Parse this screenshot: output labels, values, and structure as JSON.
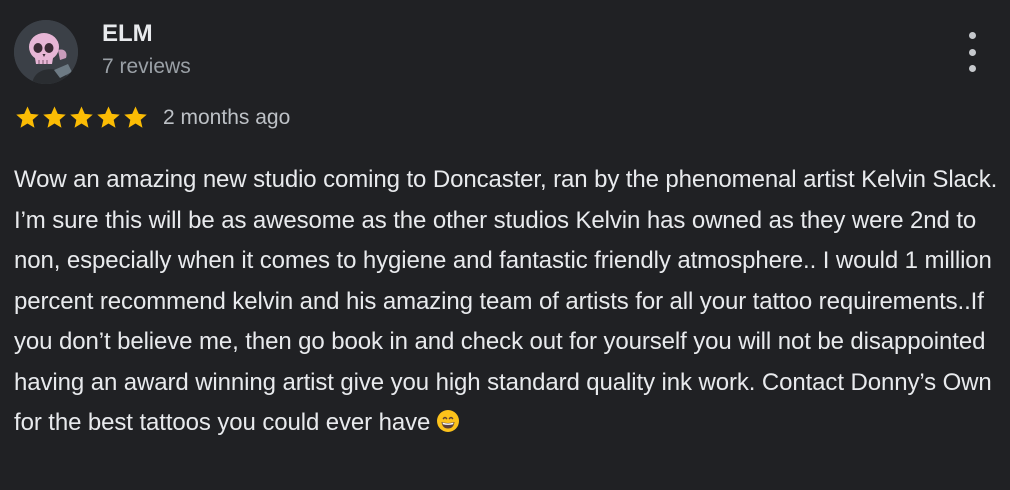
{
  "review": {
    "author_name": "ELM",
    "author_meta": "7 reviews",
    "rating": 5,
    "rating_max": 5,
    "date": "2 months ago",
    "text": "Wow an amazing new studio coming to Doncaster, ran by the phenomenal artist Kelvin Slack. I’m sure this will be as awesome as the other studios Kelvin has owned as they were 2nd to non, especially when it comes to hygiene and fantastic friendly atmosphere.. I would 1 million percent recommend kelvin and his amazing team of artists for all your tattoo requirements..If you don’t believe me, then go book in and check out for yourself you will not be disappointed having an award winning artist give you high standard quality ink work. Contact Donny’s Own for the best tattoos you could ever have"
  },
  "icons": {
    "avatar": "skull-avatar-icon",
    "more": "more-vertical-icon",
    "star": "star-icon",
    "emoji": "grinning-face-emoji-icon"
  },
  "colors": {
    "background": "#202124",
    "text_primary": "#e8eaed",
    "text_secondary": "#9aa0a6",
    "star": "#fbbc04"
  }
}
